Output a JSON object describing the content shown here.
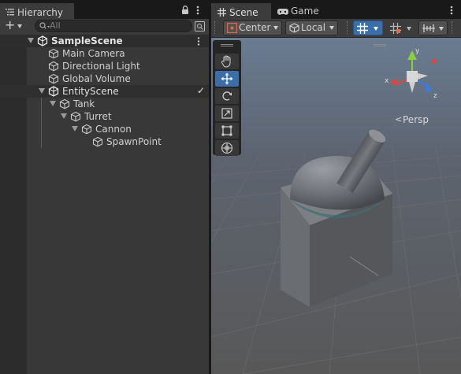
{
  "hierarchy": {
    "tab_label": "Hierarchy",
    "search_placeholder": "All",
    "add_label": "+",
    "scene_name": "SampleScene",
    "items": [
      {
        "label": "Main Camera"
      },
      {
        "label": "Directional Light"
      },
      {
        "label": "Global Volume"
      },
      {
        "label": "EntityScene"
      },
      {
        "label": "Tank"
      },
      {
        "label": "Turret"
      },
      {
        "label": "Cannon"
      },
      {
        "label": "SpawnPoint"
      }
    ],
    "subscene_checkmark": "✓"
  },
  "scene": {
    "tabs": [
      {
        "label": "Scene"
      },
      {
        "label": "Game"
      }
    ],
    "pivot_mode": "Center",
    "pivot_rotation": "Local",
    "persp_label": "Persp",
    "gizmo_axes": {
      "x": "x",
      "y": "y",
      "z": "z"
    }
  },
  "colors": {
    "accent": "#4d85c9",
    "gizmo_x": "#e2453b",
    "gizmo_y": "#8bce45",
    "gizmo_z": "#3f7bd8",
    "toolbar_icon_red": "#e06b4a"
  }
}
